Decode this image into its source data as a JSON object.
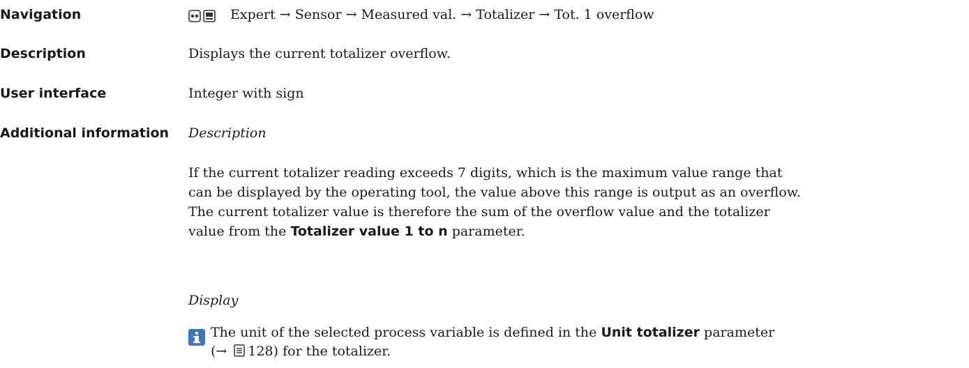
{
  "navigation": {
    "label": "Navigation",
    "path": "Expert → Sensor → Measured val. → Totalizer → Tot. 1 overflow"
  },
  "description": {
    "label": "Description",
    "text": "Displays the current totalizer overflow."
  },
  "user_interface": {
    "label": "User interface",
    "text": "Integer with sign"
  },
  "additional_information": {
    "label": "Additional information",
    "description_heading": "Description",
    "paragraph_line1": "If the current totalizer reading exceeds 7 digits, which is the maximum value range that",
    "paragraph_line2": "can be displayed by the operating tool, the value above this range is output as an overflow.",
    "paragraph_line3": "The current totalizer value is therefore the sum of the overflow value and the totalizer",
    "paragraph_line4_before": "value from the ",
    "paragraph_line4_bold": "Totalizer value 1 to n",
    "paragraph_line4_after": " parameter.",
    "display_heading": "Display",
    "note_before": "The unit of the selected process variable is defined in the ",
    "note_bold": "Unit totalizer",
    "note_after_line1": " parameter",
    "note_ref_prefix": "(→ ",
    "note_ref_page": "128",
    "note_ref_suffix": ") for the totalizer.",
    "info_icon": "info-icon",
    "book_icon": "page-reference-icon"
  },
  "colors": {
    "info_icon_bg": "#3f78b5"
  }
}
